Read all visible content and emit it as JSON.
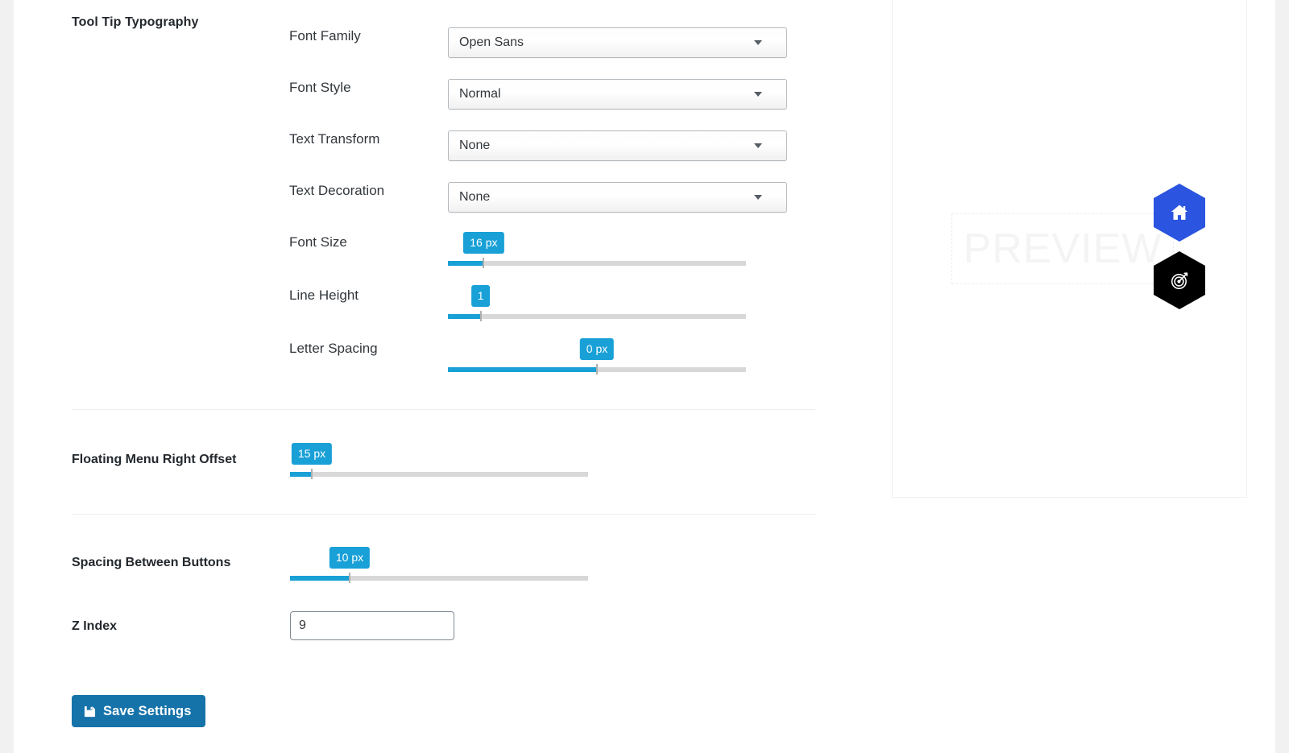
{
  "section": {
    "title": "Tool Tip Typography"
  },
  "typography_fields": [
    {
      "label": "Font Family",
      "type": "select",
      "value": "Open Sans"
    },
    {
      "label": "Font Style",
      "type": "select",
      "value": "Normal"
    },
    {
      "label": "Text Transform",
      "type": "select",
      "value": "None"
    },
    {
      "label": "Text Decoration",
      "type": "select",
      "value": "None"
    }
  ],
  "typography_sliders": [
    {
      "label": "Font Size",
      "value": "16 px",
      "percent": 12
    },
    {
      "label": "Line Height",
      "value": "1",
      "percent": 11
    },
    {
      "label": "Letter Spacing",
      "value": "0 px",
      "percent": 50
    }
  ],
  "standalone_sliders": [
    {
      "label": "Floating Menu Right Offset",
      "value": "15 px",
      "percent": 7
    },
    {
      "label": "Spacing Between Buttons",
      "value": "10 px",
      "percent": 20
    }
  ],
  "z_index": {
    "label": "Z Index",
    "value": "9"
  },
  "save": {
    "label": "Save Settings",
    "icon": "save-floppy-icon"
  },
  "preview": {
    "watermark": "PREVIEW",
    "buttons": [
      {
        "icon": "home-icon",
        "color": "#2b55e0"
      },
      {
        "icon": "target-icon",
        "color": "#000000"
      }
    ]
  },
  "colors": {
    "slider_accent": "#18a0d7",
    "save_button": "#1573aa",
    "hex_primary": "#2b55e0",
    "hex_secondary": "#000000"
  }
}
